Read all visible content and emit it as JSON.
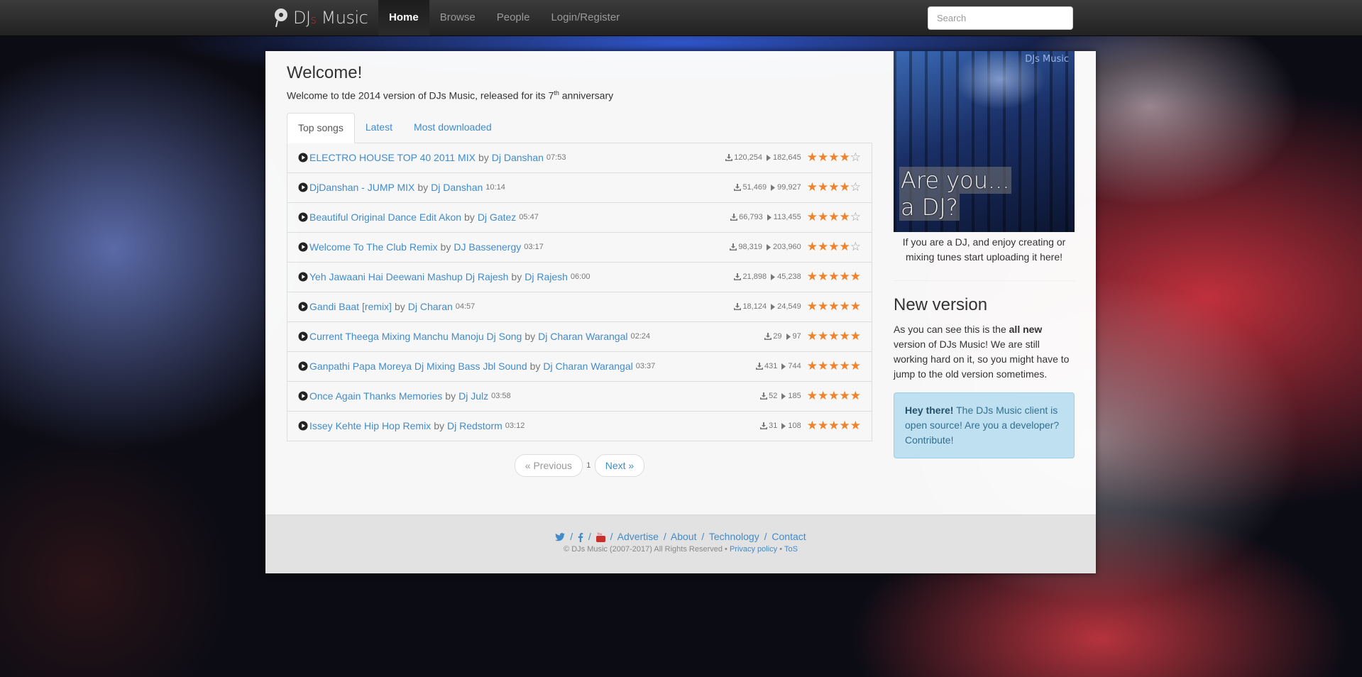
{
  "nav": {
    "brand": {
      "main1": "DJ",
      "s": "s",
      "main2": " Music"
    },
    "links": [
      "Home",
      "Browse",
      "People",
      "Login/Register"
    ],
    "search_placeholder": "Search"
  },
  "main": {
    "title": "Welcome!",
    "lead_pre": "Welcome to tde 2014 version of DJs Music, released for its 7",
    "lead_sup": "th",
    "lead_post": " anniversary",
    "tabs": [
      "Top songs",
      "Latest",
      "Most downloaded"
    ],
    "by": "by",
    "songs": [
      {
        "title": "ELECTRO HOUSE TOP 40 2011 MIX",
        "artist": "Dj Danshan",
        "duration": "07:53",
        "downloads": "120,254",
        "plays": "182,645",
        "rating": 4
      },
      {
        "title": "DjDanshan - JUMP MIX",
        "artist": "Dj Danshan",
        "duration": "10:14",
        "downloads": "51,469",
        "plays": "99,927",
        "rating": 4
      },
      {
        "title": "Beautiful Original Dance Edit Akon",
        "artist": "Dj Gatez",
        "duration": "05:47",
        "downloads": "66,793",
        "plays": "113,455",
        "rating": 4
      },
      {
        "title": "Welcome To The Club Remix",
        "artist": "DJ Bassenergy",
        "duration": "03:17",
        "downloads": "98,319",
        "plays": "203,960",
        "rating": 4
      },
      {
        "title": "Yeh Jawaani Hai Deewani Mashup Dj Rajesh",
        "artist": "Dj Rajesh",
        "duration": "06:00",
        "downloads": "21,898",
        "plays": "45,238",
        "rating": 5
      },
      {
        "title": "Gandi Baat [remix]",
        "artist": "Dj Charan",
        "duration": "04:57",
        "downloads": "18,124",
        "plays": "24,549",
        "rating": 5
      },
      {
        "title": "Current Theega Mixing Manchu Manoju Dj Song",
        "artist": "Dj Charan Warangal",
        "duration": "02:24",
        "downloads": "29",
        "plays": "97",
        "rating": 5
      },
      {
        "title": "Ganpathi Papa Moreya Dj Mixing Bass Jbl Sound",
        "artist": "Dj Charan Warangal",
        "duration": "03:37",
        "downloads": "431",
        "plays": "744",
        "rating": 5
      },
      {
        "title": "Once Again Thanks Memories",
        "artist": "Dj Julz",
        "duration": "03:58",
        "downloads": "52",
        "plays": "185",
        "rating": 5
      },
      {
        "title": "Issey Kehte Hip Hop Remix",
        "artist": "Dj Redstorm",
        "duration": "03:12",
        "downloads": "31",
        "plays": "108",
        "rating": 5
      }
    ],
    "pager": {
      "previous": "« Previous",
      "page": "1",
      "next": "Next »"
    }
  },
  "sidebar": {
    "image_mark": "DJs Music",
    "image_line1": "Are you...",
    "image_line2": "a DJ?",
    "caption": "If you are a DJ, and enjoy creating or mixing tunes start uploading it here!",
    "heading": "New version",
    "nv_pre": "As you can see this is the ",
    "nv_bold": "all new",
    "nv_post": " version of DJs Music! We are still working hard on it, so you might have to jump to the old version sometimes.",
    "alert_bold": "Hey there!",
    "alert_text": " The DJs Music client is open source! Are you a developer? Contribute!"
  },
  "footer": {
    "links": [
      "Advertise",
      "About",
      "Technology",
      "Contact"
    ],
    "separator": "/",
    "copyright": "© DJs Music (2007-2017) All Rights Reserved •",
    "privacy": "Privacy policy",
    "dot": "•",
    "tos": "ToS"
  },
  "colors": {
    "accent": "#428bca",
    "star": "#f0822a",
    "navbar": "#222222",
    "alert_bg": "#bfe0f0"
  },
  "icons": [
    "dj-logo-icon",
    "play-circle-icon",
    "download-icon",
    "play-count-icon",
    "star-icon",
    "twitter-icon",
    "facebook-icon",
    "youtube-icon"
  ]
}
